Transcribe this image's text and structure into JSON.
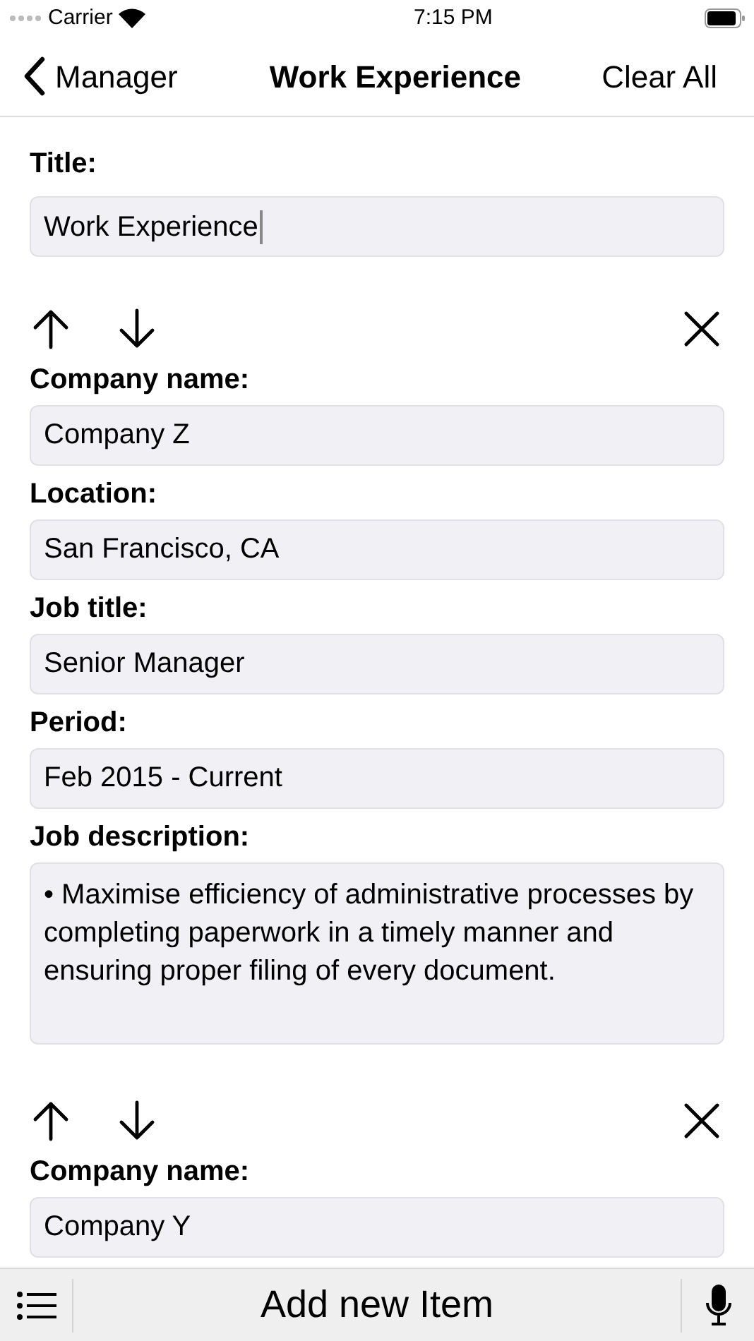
{
  "status_bar": {
    "carrier": "Carrier",
    "time": "7:15 PM"
  },
  "nav": {
    "back": "Manager",
    "title": "Work Experience",
    "action": "Clear All"
  },
  "title_field": {
    "label": "Title:",
    "value": "Work Experience",
    "focused": true
  },
  "items": [
    {
      "fields": [
        {
          "kind": "line",
          "label": "Company name:",
          "value": "Company Z"
        },
        {
          "kind": "line",
          "label": "Location:",
          "value": "San Francisco, CA"
        },
        {
          "kind": "line",
          "label": "Job title:",
          "value": "Senior Manager"
        },
        {
          "kind": "line",
          "label": "Period:",
          "value": "Feb 2015 - Current"
        },
        {
          "kind": "multi",
          "label": "Job description:",
          "value": "• Maximise efficiency of administrative processes by completing paperwork in a timely manner and ensuring proper filing of every document."
        }
      ]
    },
    {
      "fields": [
        {
          "kind": "line",
          "label": "Company name:",
          "value": "Company Y"
        }
      ]
    }
  ],
  "bottom_bar": {
    "button": "Add new Item"
  }
}
